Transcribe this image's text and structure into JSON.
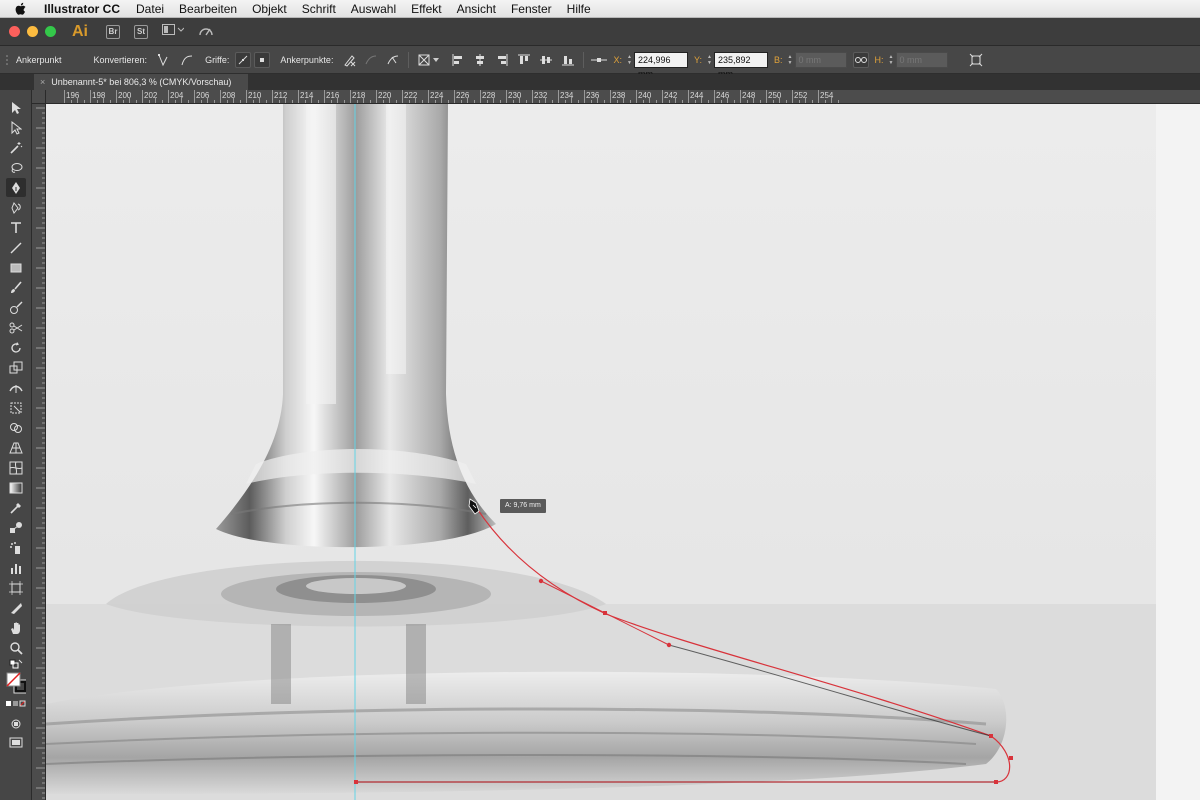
{
  "menubar": {
    "app_name": "Illustrator CC",
    "items": [
      "Datei",
      "Bearbeiten",
      "Objekt",
      "Schrift",
      "Auswahl",
      "Effekt",
      "Ansicht",
      "Fenster",
      "Hilfe"
    ]
  },
  "appbar": {
    "logo": "Ai",
    "badges": [
      "Br",
      "St"
    ]
  },
  "controlbar": {
    "tool_name": "Ankerpunkt",
    "convert_label": "Konvertieren:",
    "handles_label": "Griffe:",
    "anchors_label": "Ankerpunkte:",
    "x_label": "X:",
    "x_value": "224,996 mm",
    "y_label": "Y:",
    "y_value": "235,892 mm",
    "w_label": "B:",
    "w_value": "0 mm",
    "h_label": "H:",
    "h_value": "0 mm"
  },
  "document": {
    "tab_title": "Unbenannt-5* bei 806,3 % (CMYK/Vorschau)",
    "close_glyph": "×"
  },
  "ruler": {
    "h_labels": [
      "196",
      "198",
      "200",
      "202",
      "204",
      "206",
      "208",
      "210",
      "212",
      "214",
      "216",
      "218",
      "220",
      "222",
      "224",
      "226",
      "228",
      "230",
      "232",
      "234",
      "236",
      "238",
      "240",
      "242",
      "244",
      "246",
      "248",
      "250",
      "252",
      "254"
    ]
  },
  "canvas": {
    "tooltip": "A: 9,76 mm",
    "path_color": "#d8333b",
    "guide_color": "#63d4e6"
  },
  "colors": {
    "accent_orange": "#e0a23a",
    "ui_dark": "#464646"
  }
}
